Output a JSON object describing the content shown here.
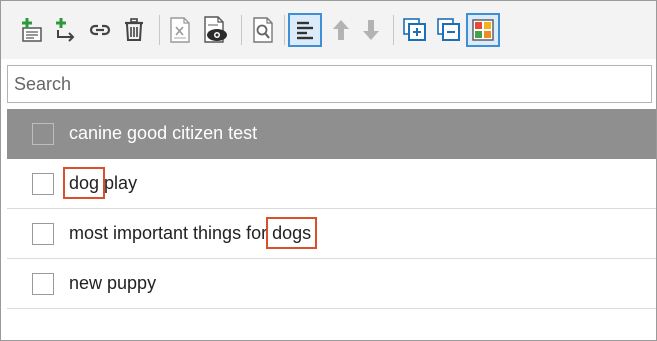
{
  "toolbar": {
    "buttons": [
      {
        "name": "add-item-icon"
      },
      {
        "name": "add-subitem-icon"
      },
      {
        "name": "link-icon"
      },
      {
        "name": "delete-icon"
      },
      {
        "name": "export-excel-icon"
      },
      {
        "name": "preview-icon"
      },
      {
        "name": "properties-icon"
      },
      {
        "name": "list-view-icon"
      },
      {
        "name": "move-up-icon"
      },
      {
        "name": "move-down-icon"
      },
      {
        "name": "expand-all-icon"
      },
      {
        "name": "collapse-all-icon"
      },
      {
        "name": "color-grid-icon"
      }
    ]
  },
  "search": {
    "placeholder": "Search",
    "value": ""
  },
  "list": {
    "items": [
      {
        "label": "canine good citizen test",
        "selected": true
      },
      {
        "label_pre": "",
        "label_highlight": "dog",
        "label_post": " play"
      },
      {
        "label_pre": "most important things for ",
        "label_highlight": "dogs",
        "label_post": ""
      },
      {
        "label": "new puppy",
        "selected": false
      }
    ]
  },
  "colors": {
    "selected_row": "#8f8f8f",
    "highlight_box": "#d9512c",
    "active_button_border": "#3f8fd6"
  }
}
